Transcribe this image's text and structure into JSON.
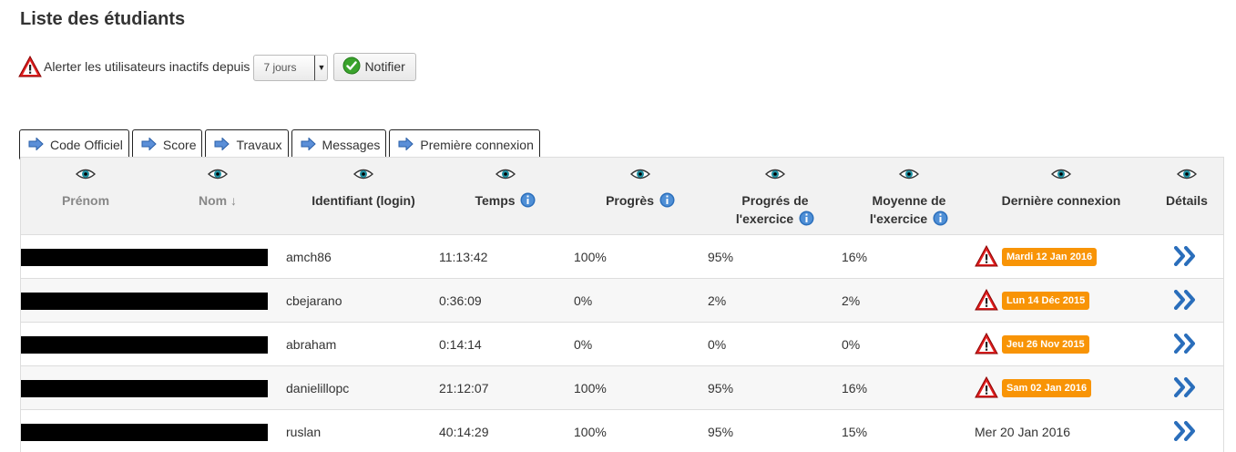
{
  "page": {
    "title": "Liste des étudiants"
  },
  "alert": {
    "label": "Alerter les utilisateurs inactifs depuis",
    "select_value": "7 jours",
    "notify_label": "Notifier"
  },
  "tabs": [
    {
      "label": "Code Officiel"
    },
    {
      "label": "Score"
    },
    {
      "label": "Travaux"
    },
    {
      "label": "Messages"
    },
    {
      "label": "Première connexion"
    }
  ],
  "columns": {
    "prenom": "Prénom",
    "nom": "Nom ↓",
    "login": "Identifiant (login)",
    "temps": "Temps",
    "progres": "Progrès",
    "progres_ex_1": "Progrés de",
    "progres_ex_2": "l'exercice",
    "moyenne_1": "Moyenne de",
    "moyenne_2": "l'exercice",
    "derniere": "Dernière connexion",
    "details": "Détails"
  },
  "rows": [
    {
      "login": "amch86",
      "temps": "11:13:42",
      "progres": "100%",
      "progres_ex": "95%",
      "moyenne": "16%",
      "derniere": "Mardi 12 Jan 2016",
      "alert": true
    },
    {
      "login": "cbejarano",
      "temps": "0:36:09",
      "progres": "0%",
      "progres_ex": "2%",
      "moyenne": "2%",
      "derniere": "Lun 14 Déc 2015",
      "alert": true
    },
    {
      "login": "abraham",
      "temps": "0:14:14",
      "progres": "0%",
      "progres_ex": "0%",
      "moyenne": "0%",
      "derniere": "Jeu 26 Nov 2015",
      "alert": true
    },
    {
      "login": "danielillopc",
      "temps": "21:12:07",
      "progres": "100%",
      "progres_ex": "95%",
      "moyenne": "16%",
      "derniere": "Sam 02 Jan 2016",
      "alert": true
    },
    {
      "login": "ruslan",
      "temps": "40:14:29",
      "progres": "100%",
      "progres_ex": "95%",
      "moyenne": "15%",
      "derniere": "Mer 20 Jan 2016",
      "alert": false
    }
  ],
  "colors": {
    "badge": "#f89406",
    "header_bg": "#f2f2f2",
    "row_alt": "#f7f7f7",
    "arrow_blue": "#2a6ebb"
  },
  "icons": {
    "warning": "warning-triangle-icon",
    "eye": "eye-icon",
    "info": "info-icon",
    "tab": "arrow-right-icon",
    "details": "double-chevron-right-icon",
    "notify": "check-circle-icon"
  }
}
